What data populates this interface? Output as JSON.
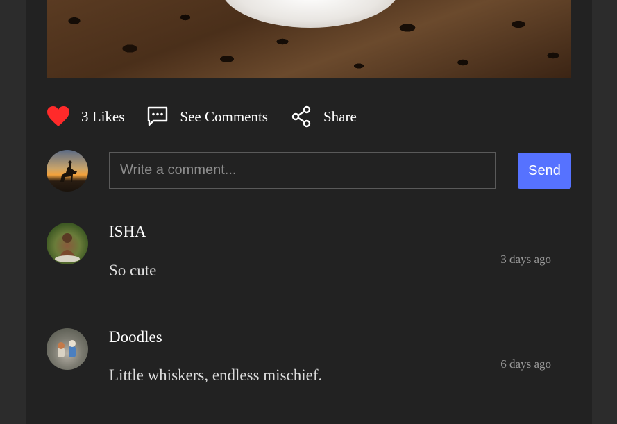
{
  "post": {
    "image_alt": "cat paws on leopard fur"
  },
  "actions": {
    "likes_label": "3 Likes",
    "comments_label": "See Comments",
    "share_label": "Share",
    "like_color": "#ff2a2a"
  },
  "comment_form": {
    "placeholder": "Write a comment...",
    "send_label": "Send",
    "send_color": "#5672ff"
  },
  "comments": [
    {
      "author": "ISHA",
      "text": "So cute",
      "time": "3 days ago"
    },
    {
      "author": "Doodles",
      "text": "Little whiskers, endless mischief.",
      "time": "6 days ago"
    }
  ]
}
